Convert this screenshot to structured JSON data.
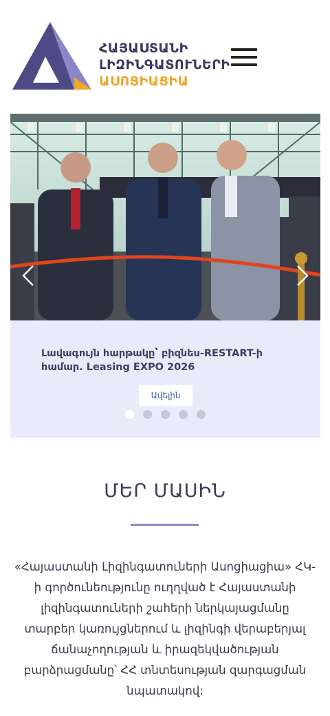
{
  "header": {
    "logo_line1": "ՀԱՅԱՍՏԱՆԻ",
    "logo_line2": "ԼԻԶԻՆԳԱՏՈՒՆԵՐԻ",
    "logo_line3": "ԱՍՈՑԻԱՑԻԱ",
    "menu_icon": "hamburger-menu-icon"
  },
  "slider": {
    "caption": "Լավագույն հարթակը՝ բիզնես-RESTART-ի համար. Leasing EXPO 2026",
    "more_label": "Ավելին",
    "slide_count": 5,
    "active_slide": 1,
    "prev_icon": "chevron-left-icon",
    "next_icon": "chevron-right-icon"
  },
  "about": {
    "title": "ՄԵՐ ՄԱՍԻՆ",
    "text": "«Հայաստանի Լիզինգատուների Ասոցիացիա» ՀԿ-ի գործունեությունը ուղղված է Հայաստանի լիզինգատուների շահերի ներկայացմանը տարբեր կառույցներում և լիզինգի վերաբերյալ ճանաչողության և իրազեկվածության բարձրացմանը՝ ՀՀ տնտեսության զարգացման նպատակով:"
  },
  "colors": {
    "brand_dark": "#3d3860",
    "brand_accent": "#f0a82a",
    "slider_bg": "#e9ebfb",
    "divider": "#8c87c6"
  }
}
